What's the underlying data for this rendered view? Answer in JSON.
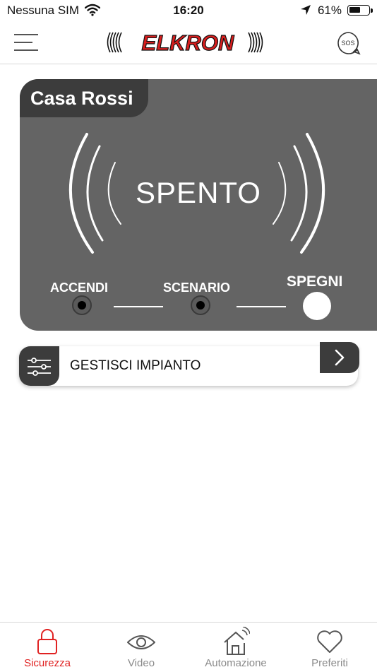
{
  "status_bar": {
    "carrier": "Nessuna SIM",
    "time": "16:20",
    "battery": "61%",
    "battery_level": 0.61
  },
  "header": {
    "logo": "ELKRON",
    "sos": "SOS"
  },
  "system": {
    "name": "Casa Rossi",
    "state": "SPENTO",
    "modes": [
      {
        "label": "ACCENDI",
        "selected": false
      },
      {
        "label": "SCENARIO",
        "selected": false
      },
      {
        "label": "SPEGNI",
        "selected": true
      }
    ]
  },
  "manage": {
    "label": "GESTISCI IMPIANTO"
  },
  "tabbar": {
    "active_color": "#e02222",
    "inactive_color": "#8a8a8a",
    "tabs": [
      {
        "label": "Sicurezza",
        "icon": "lock-icon",
        "active": true
      },
      {
        "label": "Video",
        "icon": "eye-icon",
        "active": false
      },
      {
        "label": "Automazione",
        "icon": "smart-home-icon",
        "active": false
      },
      {
        "label": "Preferiti",
        "icon": "heart-icon",
        "active": false
      }
    ]
  },
  "colors": {
    "card_background": "#646464",
    "card_dark": "#3c3c3c",
    "accent_red": "#e02222"
  }
}
